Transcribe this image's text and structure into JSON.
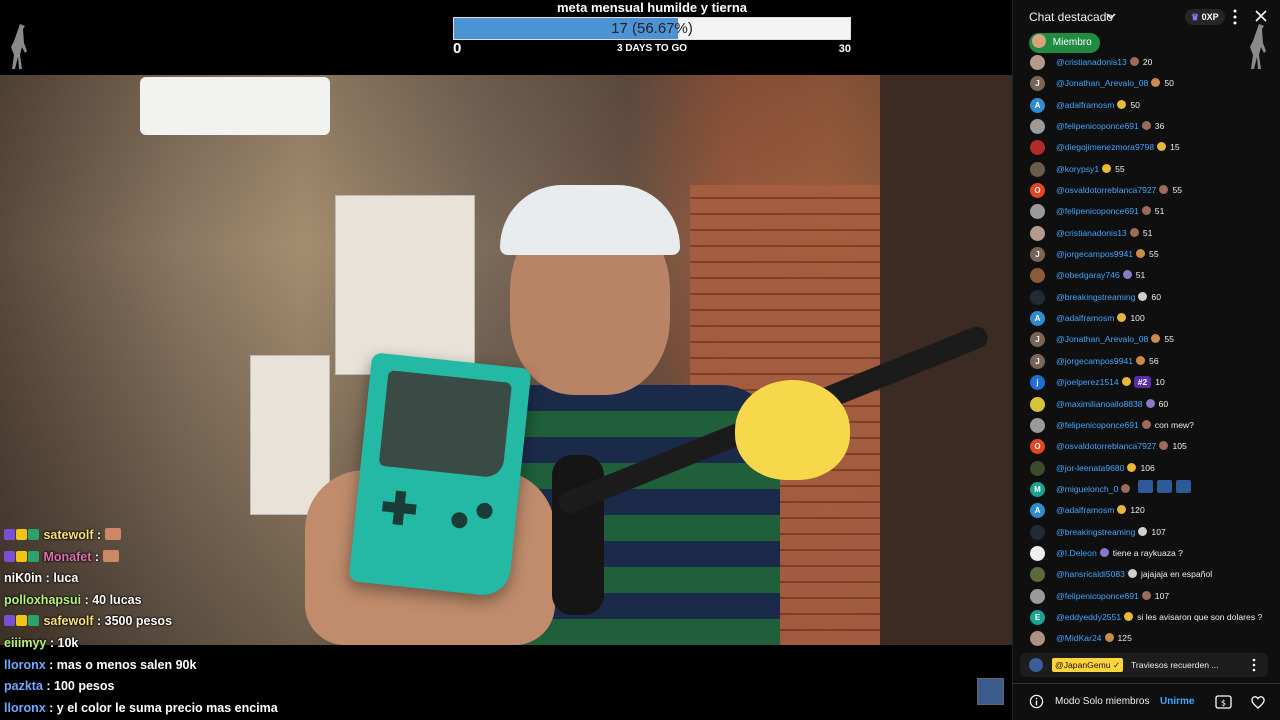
{
  "goal": {
    "title": "meta mensual humilde y tierna",
    "progress_text": "17 (56.67%)",
    "progress_fraction": 0.5667,
    "min": "0",
    "max": "30",
    "days_left": "3 DAYS TO GO"
  },
  "twitch_chat": [
    {
      "user": "satewolf",
      "sep": " :",
      "text": "",
      "color": "#f7e27a",
      "badges": [
        "#7a4fd6",
        "#f0c419",
        "#2ea26b"
      ],
      "emote": true
    },
    {
      "user": "Monafet",
      "sep": " :",
      "text": "",
      "color": "#e06fb0",
      "badges": [
        "#7a4fd6",
        "#f0c419",
        "#2ea26b"
      ],
      "emote": true
    },
    {
      "user": "niK0in",
      "sep": " :",
      "text": " luca",
      "color": "#ffffff",
      "badges": [],
      "emote": false
    },
    {
      "user": "polloxhapsui",
      "sep": " :",
      "text": " 40 lucas",
      "color": "#b6f27a",
      "badges": [],
      "emote": false
    },
    {
      "user": "safewolf",
      "sep": " :",
      "text": " 3500 pesos",
      "color": "#f7e27a",
      "badges": [
        "#7a4fd6",
        "#f0c419",
        "#2ea26b"
      ],
      "emote": false
    },
    {
      "user": "eiiimyy",
      "sep": " :",
      "text": " 10k",
      "color": "#b6f27a",
      "badges": [],
      "emote": false
    },
    {
      "user": "lloronx",
      "sep": " :",
      "text": " mas o menos salen 90k",
      "color": "#6ea8ff",
      "badges": [],
      "emote": false
    },
    {
      "user": "pazkta",
      "sep": " :",
      "text": " 100 pesos",
      "color": "#6ea8ff",
      "badges": [],
      "emote": false
    },
    {
      "user": "lloronx",
      "sep": " :",
      "text": " y el color le suma precio mas encima",
      "color": "#6ea8ff",
      "badges": [],
      "emote": false
    }
  ],
  "yt": {
    "header_title": "Chat destacado",
    "xp": "0XP",
    "member_chip": "Miembro",
    "messages": [
      {
        "author": "@cristianadonis13",
        "text": "20",
        "initial": "",
        "avatar_color": "#b39a8a",
        "badge": "#9d6b5a",
        "rank": ""
      },
      {
        "author": "@Jonathan_Arevalo_08",
        "text": "50",
        "initial": "J",
        "avatar_color": "#7a6458",
        "badge": "#c98a4a",
        "rank": ""
      },
      {
        "author": "@adalframosm",
        "text": "50",
        "initial": "A",
        "avatar_color": "#2f8ccf",
        "badge": "#e7b83a",
        "rank": ""
      },
      {
        "author": "@felipenicoponce691",
        "text": "36",
        "initial": "",
        "avatar_color": "#9a9a9a",
        "badge": "#9d6b5a",
        "rank": ""
      },
      {
        "author": "@diegojimenezmora9798",
        "text": "15",
        "initial": "",
        "avatar_color": "#b02a2a",
        "badge": "#e7b83a",
        "rank": ""
      },
      {
        "author": "@korypsy1",
        "text": "55",
        "initial": "",
        "avatar_color": "#6b5b4a",
        "badge": "#e7b83a",
        "rank": ""
      },
      {
        "author": "@osvaldotorreblanca7927",
        "text": "55",
        "initial": "O",
        "avatar_color": "#e5461e",
        "badge": "#9d6b5a",
        "rank": ""
      },
      {
        "author": "@felipenicoponce691",
        "text": "51",
        "initial": "",
        "avatar_color": "#9a9a9a",
        "badge": "#9d6b5a",
        "rank": ""
      },
      {
        "author": "@cristianadonis13",
        "text": "51",
        "initial": "",
        "avatar_color": "#b39a8a",
        "badge": "#9d6b5a",
        "rank": ""
      },
      {
        "author": "@jorgecampos9941",
        "text": "55",
        "initial": "J",
        "avatar_color": "#7a6458",
        "badge": "#c98a4a",
        "rank": ""
      },
      {
        "author": "@obedgaray746",
        "text": "51",
        "initial": "",
        "avatar_color": "#8a5a3a",
        "badge": "#8a78c9",
        "rank": ""
      },
      {
        "author": "@breakingstreaming",
        "text": "60",
        "initial": "",
        "avatar_color": "#222a35",
        "badge": "#cfcfcf",
        "rank": ""
      },
      {
        "author": "@adalframosm",
        "text": "100",
        "initial": "A",
        "avatar_color": "#2f8ccf",
        "badge": "#e7b83a",
        "rank": ""
      },
      {
        "author": "@Jonathan_Arevalo_08",
        "text": "55",
        "initial": "J",
        "avatar_color": "#7a6458",
        "badge": "#c98a4a",
        "rank": ""
      },
      {
        "author": "@jorgecampos9941",
        "text": "56",
        "initial": "J",
        "avatar_color": "#7a6458",
        "badge": "#c98a4a",
        "rank": ""
      },
      {
        "author": "@joelperez1514",
        "text": "10",
        "initial": "j",
        "avatar_color": "#1f6fd0",
        "badge": "#e7b83a",
        "rank": "#2"
      },
      {
        "author": "@maximilianoallo8838",
        "text": "60",
        "initial": "",
        "avatar_color": "#d8c23a",
        "badge": "#8a78c9",
        "rank": ""
      },
      {
        "author": "@felipenicoponce691",
        "text": "con mew?",
        "initial": "",
        "avatar_color": "#9a9a9a",
        "badge": "#9d6b5a",
        "rank": ""
      },
      {
        "author": "@osvaldotorreblanca7927",
        "text": "105",
        "initial": "O",
        "avatar_color": "#e5461e",
        "badge": "#9d6b5a",
        "rank": ""
      },
      {
        "author": "@jor-leenata9680",
        "text": "106",
        "initial": "",
        "avatar_color": "#3a4a2a",
        "badge": "#e7b83a",
        "rank": ""
      },
      {
        "author": "@miguelonch_0",
        "text": "",
        "initial": "M",
        "avatar_color": "#19a390",
        "badge": "#9d6b5a",
        "rank": ""
      },
      {
        "author": "@adalframosm",
        "text": "120",
        "initial": "A",
        "avatar_color": "#2f8ccf",
        "badge": "#e7b83a",
        "rank": ""
      },
      {
        "author": "@breakingstreaming",
        "text": "107",
        "initial": "",
        "avatar_color": "#222a35",
        "badge": "#cfcfcf",
        "rank": ""
      },
      {
        "author": "@I.Deleon",
        "text": "tiene a raykuaza ?",
        "initial": "",
        "avatar_color": "#eeeeee",
        "badge": "#8a78c9",
        "rank": ""
      },
      {
        "author": "@hansricaldi5083",
        "text": "jajajaja en español",
        "initial": "",
        "avatar_color": "#5a6a3a",
        "badge": "#cfcfcf",
        "rank": ""
      },
      {
        "author": "@felipenicoponce691",
        "text": "107",
        "initial": "",
        "avatar_color": "#9a9a9a",
        "badge": "#9d6b5a",
        "rank": ""
      },
      {
        "author": "@eddyeddy2551",
        "text": "si les avisaron que son dolares ?",
        "initial": "E",
        "avatar_color": "#19a390",
        "badge": "#e7b83a",
        "rank": ""
      },
      {
        "author": "@MidKar24",
        "text": "125",
        "initial": "",
        "avatar_color": "#b09080",
        "badge": "#c98a4a",
        "rank": ""
      }
    ],
    "pinned": {
      "author": "@JapanGemu",
      "text": "Traviesos recuerden ..."
    },
    "footer": {
      "members_mode": "Modo Solo miembros",
      "join": "Unirme"
    }
  }
}
